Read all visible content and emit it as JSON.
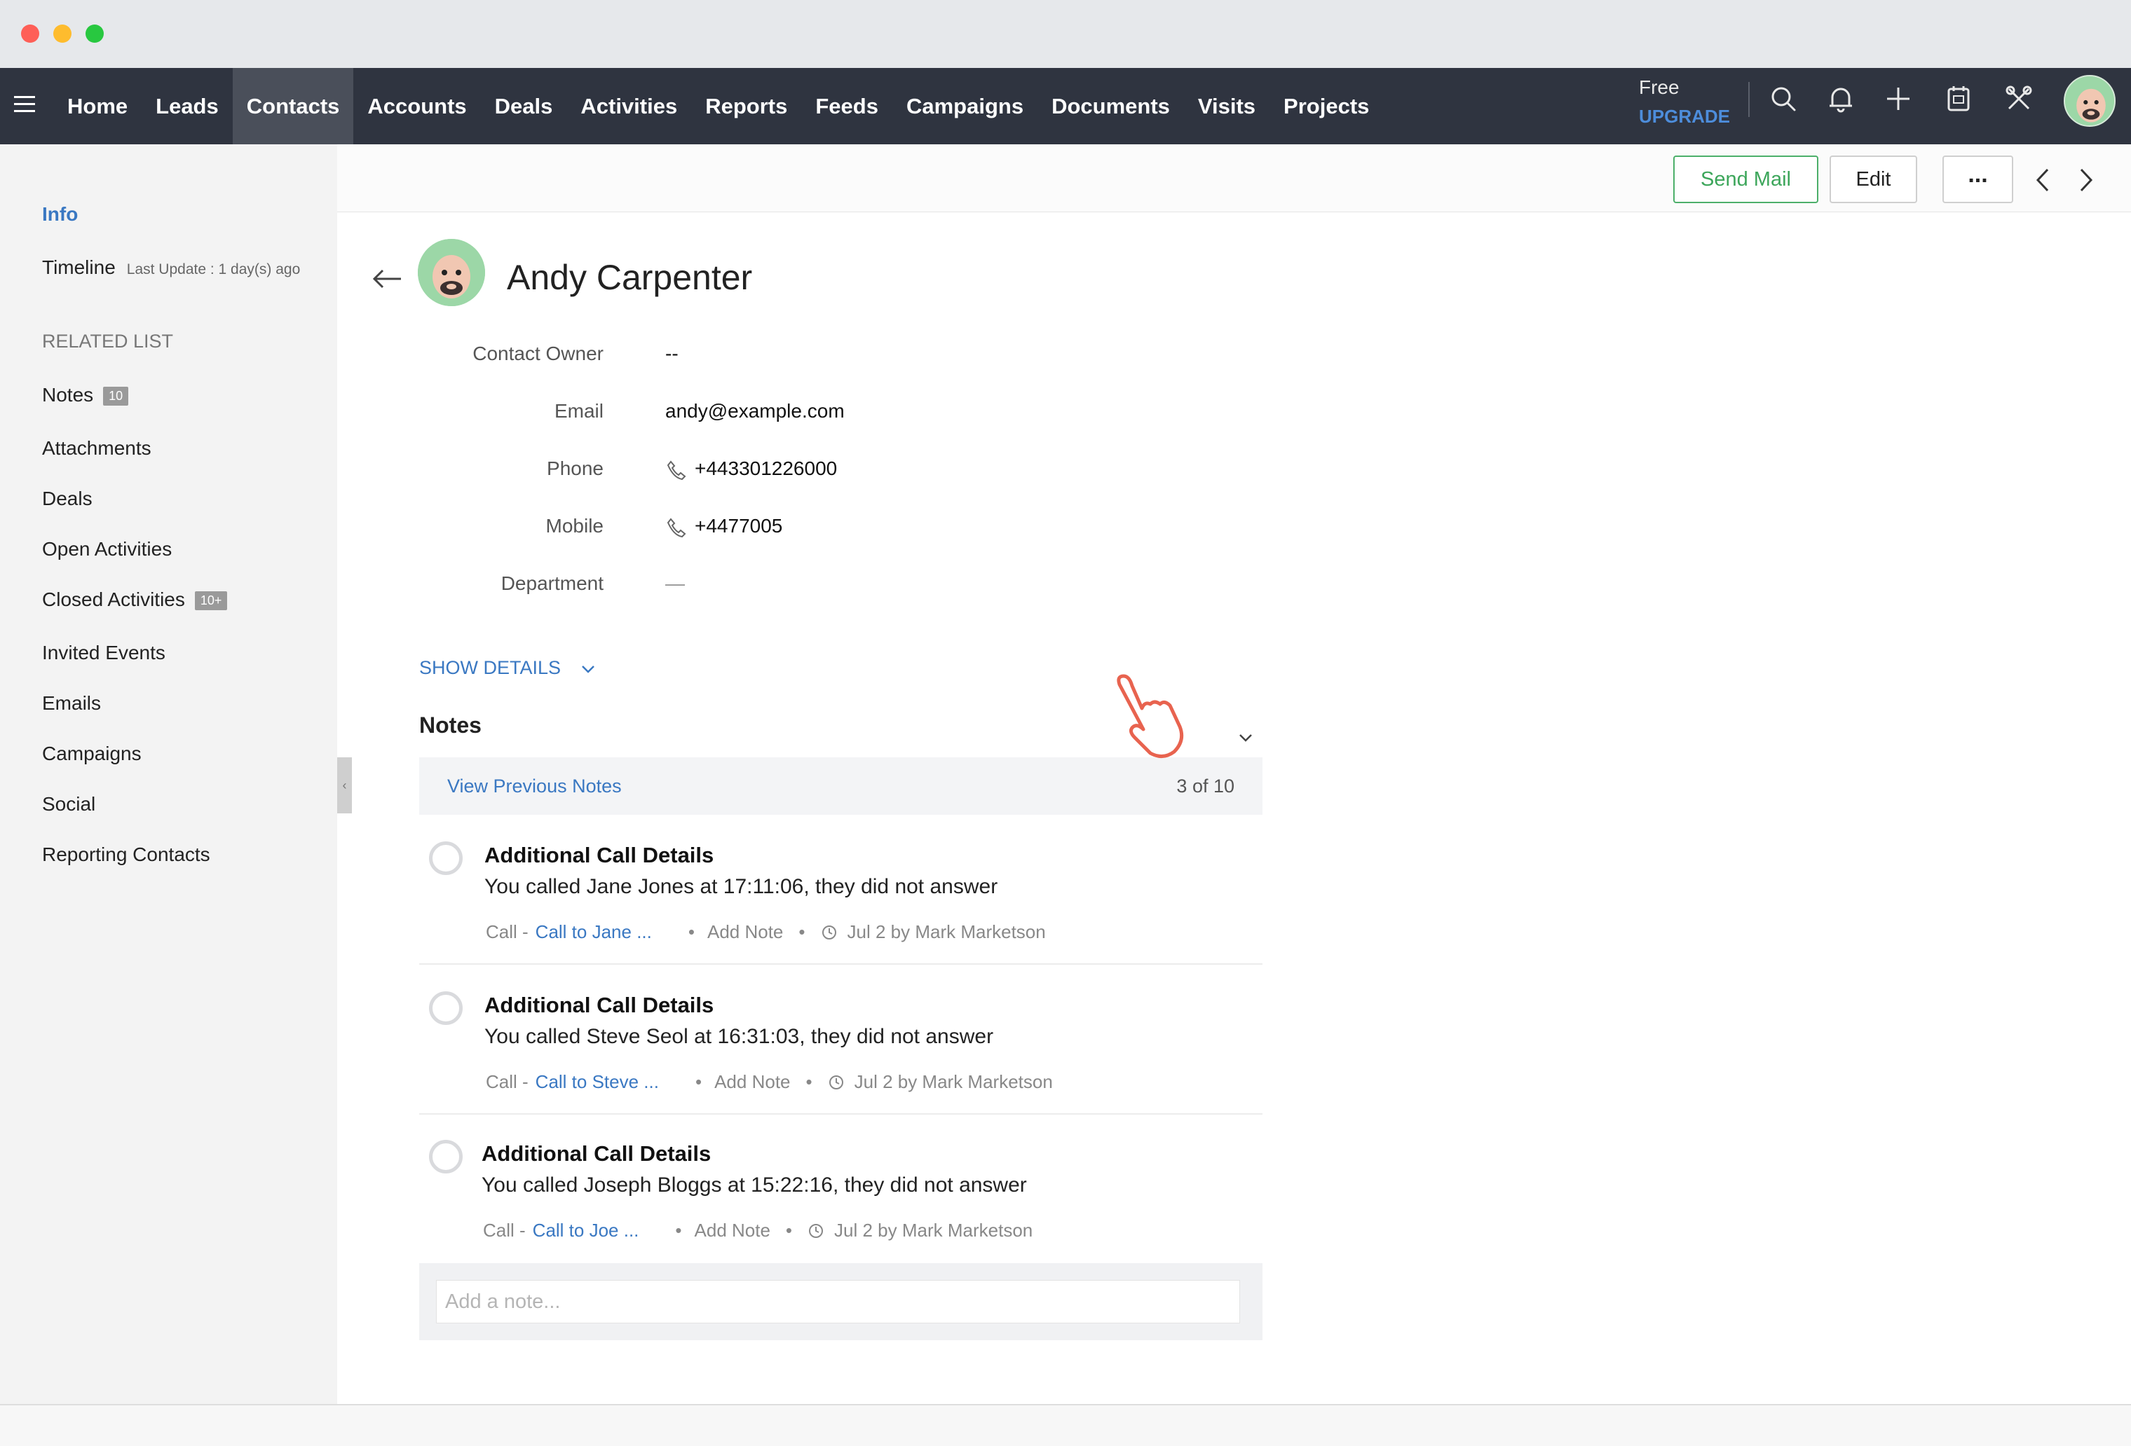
{
  "nav": {
    "items": [
      "Home",
      "Leads",
      "Contacts",
      "Accounts",
      "Deals",
      "Activities",
      "Reports",
      "Feeds",
      "Campaigns",
      "Documents",
      "Visits",
      "Projects"
    ],
    "active": "Contacts",
    "plan_label": "Free",
    "upgrade_label": "UPGRADE",
    "icons": [
      "search-icon",
      "bell-icon",
      "plus-icon",
      "calendar-icon",
      "tools-icon"
    ]
  },
  "sidebar": {
    "info": "Info",
    "timeline": "Timeline",
    "timeline_sub": "Last Update : 1 day(s) ago",
    "related_heading": "RELATED LIST",
    "items": [
      {
        "label": "Notes",
        "badge": "10"
      },
      {
        "label": "Attachments",
        "badge": ""
      },
      {
        "label": "Deals",
        "badge": ""
      },
      {
        "label": "Open Activities",
        "badge": ""
      },
      {
        "label": "Closed Activities",
        "badge": "10+"
      },
      {
        "label": "Invited Events",
        "badge": ""
      },
      {
        "label": "Emails",
        "badge": ""
      },
      {
        "label": "Campaigns",
        "badge": ""
      },
      {
        "label": "Social",
        "badge": ""
      },
      {
        "label": "Reporting Contacts",
        "badge": ""
      }
    ]
  },
  "toolbar": {
    "send_mail": "Send Mail",
    "edit": "Edit",
    "more": "..."
  },
  "contact": {
    "name": "Andy Carpenter",
    "fields": [
      {
        "label": "Contact Owner",
        "value": "--"
      },
      {
        "label": "Email",
        "value": "andy@example.com"
      },
      {
        "label": "Phone",
        "value": "+443301226000"
      },
      {
        "label": "Mobile",
        "value": "+4477005"
      },
      {
        "label": "Department",
        "value": "—"
      }
    ],
    "show_details": "SHOW DETAILS"
  },
  "notes": {
    "title": "Notes",
    "view_previous": "View Previous Notes",
    "count": "3 of 10",
    "items": [
      {
        "title": "Additional Call Details",
        "body": "You called Jane Jones at 17:11:06, they did not answer",
        "type": "Call -",
        "link": "Call to Jane ...",
        "add_note": "Add Note",
        "meta": "Jul 2 by Mark Marketson"
      },
      {
        "title": "Additional Call Details",
        "body": "You called Steve Seol at 16:31:03, they did not answer",
        "type": "Call -",
        "link": "Call to Steve ...",
        "add_note": "Add Note",
        "meta": "Jul 2 by Mark Marketson"
      },
      {
        "title": "Additional Call Details",
        "body": "You called Joseph Bloggs at 15:22:16, they did not answer",
        "type": "Call -",
        "link": "Call to Joe ...",
        "add_note": "Add Note",
        "meta": "Jul 2 by Mark Marketson"
      }
    ],
    "add_placeholder": "Add a note..."
  },
  "colors": {
    "nav_bg": "#2f3440",
    "accent": "#3a78c2",
    "send_green": "#3da65b"
  }
}
